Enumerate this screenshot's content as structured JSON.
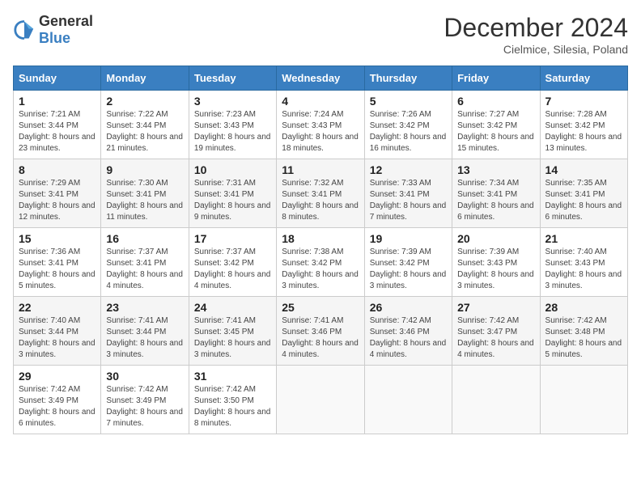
{
  "logo": {
    "general": "General",
    "blue": "Blue"
  },
  "header": {
    "month": "December 2024",
    "location": "Cielmice, Silesia, Poland"
  },
  "weekdays": [
    "Sunday",
    "Monday",
    "Tuesday",
    "Wednesday",
    "Thursday",
    "Friday",
    "Saturday"
  ],
  "weeks": [
    [
      {
        "day": "1",
        "sunrise": "7:21 AM",
        "sunset": "3:44 PM",
        "daylight": "8 hours and 23 minutes."
      },
      {
        "day": "2",
        "sunrise": "7:22 AM",
        "sunset": "3:44 PM",
        "daylight": "8 hours and 21 minutes."
      },
      {
        "day": "3",
        "sunrise": "7:23 AM",
        "sunset": "3:43 PM",
        "daylight": "8 hours and 19 minutes."
      },
      {
        "day": "4",
        "sunrise": "7:24 AM",
        "sunset": "3:43 PM",
        "daylight": "8 hours and 18 minutes."
      },
      {
        "day": "5",
        "sunrise": "7:26 AM",
        "sunset": "3:42 PM",
        "daylight": "8 hours and 16 minutes."
      },
      {
        "day": "6",
        "sunrise": "7:27 AM",
        "sunset": "3:42 PM",
        "daylight": "8 hours and 15 minutes."
      },
      {
        "day": "7",
        "sunrise": "7:28 AM",
        "sunset": "3:42 PM",
        "daylight": "8 hours and 13 minutes."
      }
    ],
    [
      {
        "day": "8",
        "sunrise": "7:29 AM",
        "sunset": "3:41 PM",
        "daylight": "8 hours and 12 minutes."
      },
      {
        "day": "9",
        "sunrise": "7:30 AM",
        "sunset": "3:41 PM",
        "daylight": "8 hours and 11 minutes."
      },
      {
        "day": "10",
        "sunrise": "7:31 AM",
        "sunset": "3:41 PM",
        "daylight": "8 hours and 9 minutes."
      },
      {
        "day": "11",
        "sunrise": "7:32 AM",
        "sunset": "3:41 PM",
        "daylight": "8 hours and 8 minutes."
      },
      {
        "day": "12",
        "sunrise": "7:33 AM",
        "sunset": "3:41 PM",
        "daylight": "8 hours and 7 minutes."
      },
      {
        "day": "13",
        "sunrise": "7:34 AM",
        "sunset": "3:41 PM",
        "daylight": "8 hours and 6 minutes."
      },
      {
        "day": "14",
        "sunrise": "7:35 AM",
        "sunset": "3:41 PM",
        "daylight": "8 hours and 6 minutes."
      }
    ],
    [
      {
        "day": "15",
        "sunrise": "7:36 AM",
        "sunset": "3:41 PM",
        "daylight": "8 hours and 5 minutes."
      },
      {
        "day": "16",
        "sunrise": "7:37 AM",
        "sunset": "3:41 PM",
        "daylight": "8 hours and 4 minutes."
      },
      {
        "day": "17",
        "sunrise": "7:37 AM",
        "sunset": "3:42 PM",
        "daylight": "8 hours and 4 minutes."
      },
      {
        "day": "18",
        "sunrise": "7:38 AM",
        "sunset": "3:42 PM",
        "daylight": "8 hours and 3 minutes."
      },
      {
        "day": "19",
        "sunrise": "7:39 AM",
        "sunset": "3:42 PM",
        "daylight": "8 hours and 3 minutes."
      },
      {
        "day": "20",
        "sunrise": "7:39 AM",
        "sunset": "3:43 PM",
        "daylight": "8 hours and 3 minutes."
      },
      {
        "day": "21",
        "sunrise": "7:40 AM",
        "sunset": "3:43 PM",
        "daylight": "8 hours and 3 minutes."
      }
    ],
    [
      {
        "day": "22",
        "sunrise": "7:40 AM",
        "sunset": "3:44 PM",
        "daylight": "8 hours and 3 minutes."
      },
      {
        "day": "23",
        "sunrise": "7:41 AM",
        "sunset": "3:44 PM",
        "daylight": "8 hours and 3 minutes."
      },
      {
        "day": "24",
        "sunrise": "7:41 AM",
        "sunset": "3:45 PM",
        "daylight": "8 hours and 3 minutes."
      },
      {
        "day": "25",
        "sunrise": "7:41 AM",
        "sunset": "3:46 PM",
        "daylight": "8 hours and 4 minutes."
      },
      {
        "day": "26",
        "sunrise": "7:42 AM",
        "sunset": "3:46 PM",
        "daylight": "8 hours and 4 minutes."
      },
      {
        "day": "27",
        "sunrise": "7:42 AM",
        "sunset": "3:47 PM",
        "daylight": "8 hours and 4 minutes."
      },
      {
        "day": "28",
        "sunrise": "7:42 AM",
        "sunset": "3:48 PM",
        "daylight": "8 hours and 5 minutes."
      }
    ],
    [
      {
        "day": "29",
        "sunrise": "7:42 AM",
        "sunset": "3:49 PM",
        "daylight": "8 hours and 6 minutes."
      },
      {
        "day": "30",
        "sunrise": "7:42 AM",
        "sunset": "3:49 PM",
        "daylight": "8 hours and 7 minutes."
      },
      {
        "day": "31",
        "sunrise": "7:42 AM",
        "sunset": "3:50 PM",
        "daylight": "8 hours and 8 minutes."
      },
      null,
      null,
      null,
      null
    ]
  ]
}
